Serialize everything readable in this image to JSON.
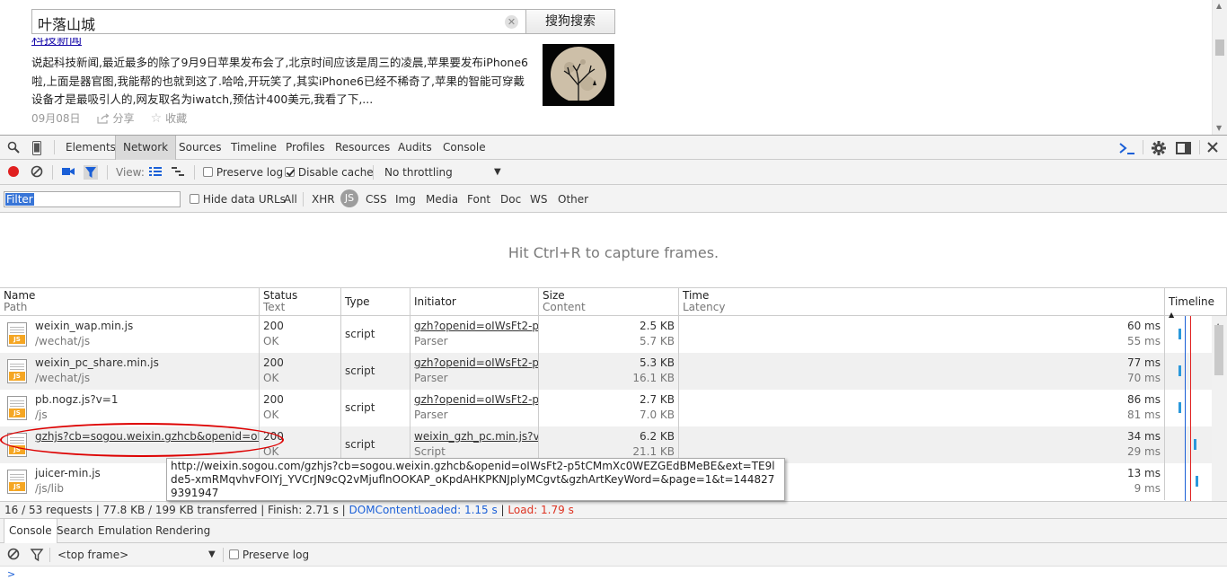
{
  "webpage": {
    "search_value": "叶落山城",
    "search_button": "搜狗搜索",
    "result_title_fragment": "科技新闻",
    "snippet": "说起科技新闻,最近最多的除了9月9日苹果发布会了,北京时间应该是周三的凌晨,苹果要发布iPhone6啦,上面是器官图,我能帮的也就到这了.哈哈,开玩笑了,其实iPhone6已经不稀奇了,苹果的智能可穿戴设备才是最吸引人的,网友取名为iwatch,预估计400美元,我看了下,...",
    "date": "09月08日",
    "share": "分享",
    "collect": "收藏"
  },
  "devtools": {
    "tabs": [
      "Elements",
      "Network",
      "Sources",
      "Timeline",
      "Profiles",
      "Resources",
      "Audits",
      "Console"
    ],
    "active_tab": "Network",
    "toolbar": {
      "view_label": "View:",
      "preserve_log": "Preserve log",
      "disable_cache": "Disable cache",
      "throttling": "No throttling"
    },
    "filter": {
      "value": "Filter",
      "hide_data_urls": "Hide data URLs",
      "types": [
        "All",
        "XHR",
        "JS",
        "CSS",
        "Img",
        "Media",
        "Font",
        "Doc",
        "WS",
        "Other"
      ],
      "active_type": "JS"
    },
    "capture_message": "Hit Ctrl+R to capture frames.",
    "columns": {
      "name": "Name",
      "name_sub": "Path",
      "status": "Status",
      "status_sub": "Text",
      "type": "Type",
      "initiator": "Initiator",
      "size": "Size",
      "size_sub": "Content",
      "time": "Time",
      "time_sub": "Latency",
      "timeline": "Timeline"
    },
    "rows": [
      {
        "name": "weixin_wap.min.js",
        "path": "/wechat/js",
        "status": "200",
        "status_text": "OK",
        "type": "script",
        "initiator": "gzh?openid=oIWsFt2-p...",
        "initiator_sub": "Parser",
        "size": "2.5 KB",
        "content": "5.7 KB",
        "time": "60 ms",
        "latency": "55 ms"
      },
      {
        "name": "weixin_pc_share.min.js",
        "path": "/wechat/js",
        "status": "200",
        "status_text": "OK",
        "type": "script",
        "initiator": "gzh?openid=oIWsFt2-p...",
        "initiator_sub": "Parser",
        "size": "5.3 KB",
        "content": "16.1 KB",
        "time": "77 ms",
        "latency": "70 ms"
      },
      {
        "name": "pb.nogz.js?v=1",
        "path": "/js",
        "status": "200",
        "status_text": "OK",
        "type": "script",
        "initiator": "gzh?openid=oIWsFt2-p...",
        "initiator_sub": "Parser",
        "size": "2.7 KB",
        "content": "7.0 KB",
        "time": "86 ms",
        "latency": "81 ms"
      },
      {
        "name": "gzhjs?cb=sogou.weixin.gzhcb&openid=oIW...",
        "path": "",
        "status": "200",
        "status_text": "OK",
        "type": "script",
        "initiator": "weixin_gzh_pc.min.js?v...",
        "initiator_sub": "Script",
        "size": "6.2 KB",
        "content": "21.1 KB",
        "time": "34 ms",
        "latency": "29 ms"
      },
      {
        "name": "juicer-min.js",
        "path": "/js/lib",
        "status": "",
        "status_text": "",
        "type": "",
        "initiator": "",
        "initiator_sub": "",
        "size": "",
        "content": "",
        "time": "13 ms",
        "latency": "9 ms"
      }
    ],
    "tooltip": "http://weixin.sogou.com/gzhjs?cb=sogou.weixin.gzhcb&openid=oIWsFt2-p5tCMmXc0WEZGEdBMeBE&ext=TE9lde5-xmRMqvhvFOIYj_YVCrJN9cQ2vMjuflnOOKAP_oKpdAHKPKNJplyMCgvt&gzhArtKeyWord=&page=1&t=1448279391947",
    "status": {
      "requests": "16 / 53 requests",
      "transferred": "77.8 KB / 199 KB transferred",
      "finish": "Finish: 2.71 s",
      "domcontentloaded": "DOMContentLoaded: 1.15 s",
      "load": "Load: 1.79 s"
    },
    "drawer_tabs": [
      "Console",
      "Search",
      "Emulation",
      "Rendering"
    ],
    "console": {
      "frame": "<top frame>",
      "preserve_log": "Preserve log",
      "prompt": ">"
    }
  }
}
